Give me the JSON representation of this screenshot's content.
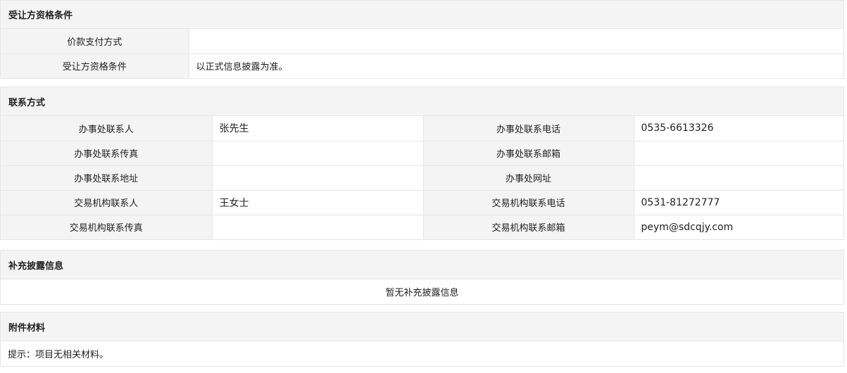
{
  "qualification": {
    "title": "受让方资格条件",
    "rows": [
      {
        "label": "价款支付方式",
        "value": ""
      },
      {
        "label": "受让方资格条件",
        "value": "以正式信息披露为准。"
      }
    ]
  },
  "contact": {
    "title": "联系方式",
    "rows": [
      {
        "l1": "办事处联系人",
        "v1": "张先生",
        "l2": "办事处联系电话",
        "v2": "0535-6613326"
      },
      {
        "l1": "办事处联系传真",
        "v1": "",
        "l2": "办事处联系邮箱",
        "v2": ""
      },
      {
        "l1": "办事处联系地址",
        "v1": "",
        "l2": "办事处网址",
        "v2": ""
      },
      {
        "l1": "交易机构联系人",
        "v1": "王女士",
        "l2": "交易机构联系电话",
        "v2": "0531-81272777"
      },
      {
        "l1": "交易机构联系传真",
        "v1": "",
        "l2": "交易机构联系邮箱",
        "v2": "peym@sdcqjy.com"
      }
    ]
  },
  "supplement": {
    "title": "补充披露信息",
    "text": "暂无补充披露信息"
  },
  "attachments": {
    "title": "附件材料",
    "text": "提示：项目无相关材料。"
  }
}
